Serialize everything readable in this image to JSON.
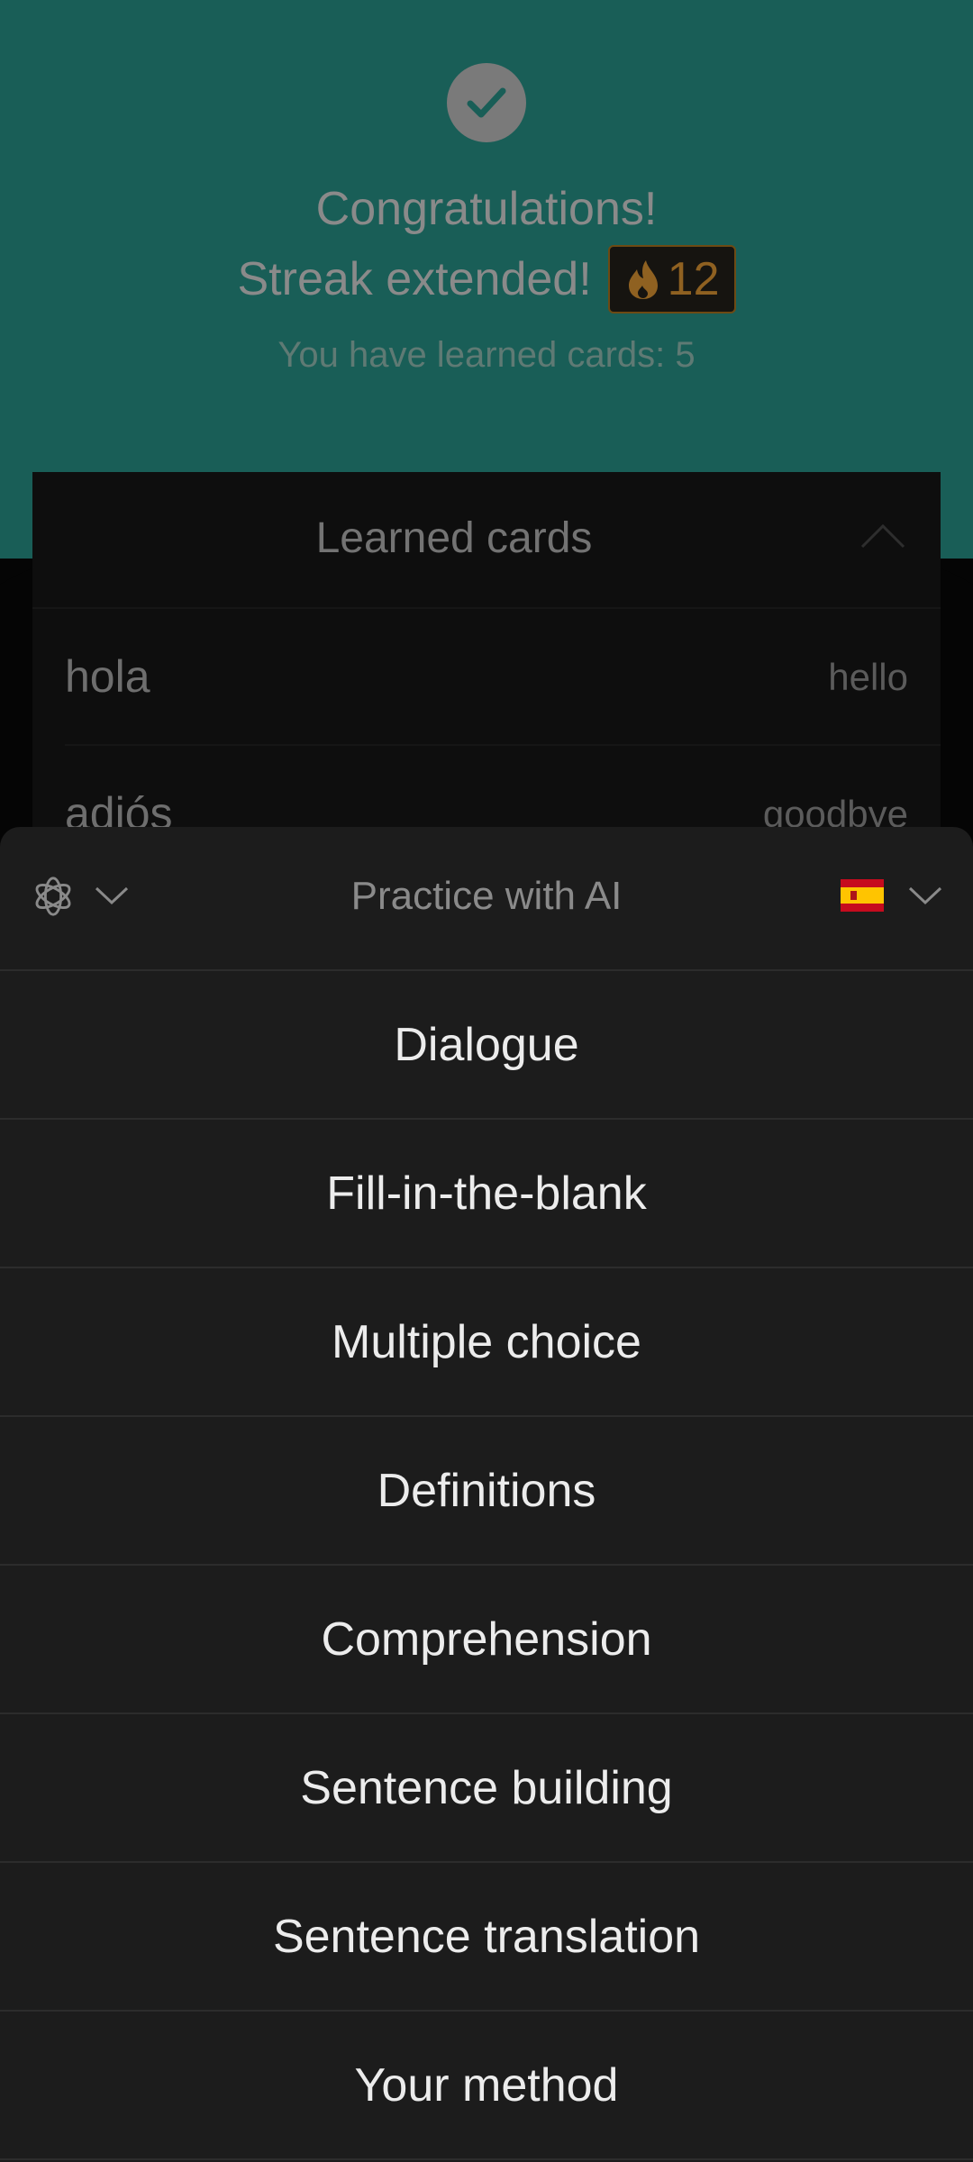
{
  "hero": {
    "title": "Congratulations!",
    "streak_text": "Streak extended!",
    "streak_count": "12",
    "streak_icon": "fire-icon",
    "learned_count_text": "You have learned cards: 5",
    "background": "#195e57"
  },
  "learned_cards": {
    "title": "Learned cards",
    "toggle_icon": "chevron-up-icon",
    "items": [
      {
        "word": "hola",
        "translation": "hello"
      },
      {
        "word": "adiós",
        "translation": "goodbye"
      }
    ]
  },
  "practice_sheet": {
    "title": "Practice with AI",
    "model_icon": "openai-icon",
    "language_flag": "spain-flag-icon",
    "options": [
      "Dialogue",
      "Fill-in-the-blank",
      "Multiple choice",
      "Definitions",
      "Comprehension",
      "Sentence building",
      "Sentence translation",
      "Your method"
    ]
  },
  "colors": {
    "accent": "#195e57",
    "streak": "#8f6121",
    "sheet": "#1c1c1c"
  }
}
